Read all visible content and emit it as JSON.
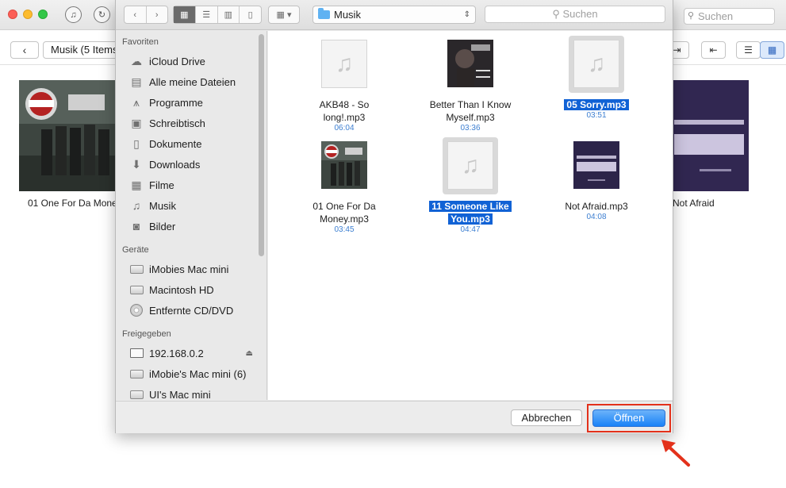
{
  "background_app": {
    "search_placeholder": "Suchen",
    "breadcrumb": "Musik (5 Items",
    "albums": [
      {
        "label": "01 One For Da Mone"
      },
      {
        "label": "Not Afraid"
      }
    ]
  },
  "dialog": {
    "path": "Musik",
    "search_placeholder": "Suchen",
    "sidebar": {
      "sections": [
        {
          "heading": "Favoriten",
          "items": [
            "iCloud Drive",
            "Alle meine Dateien",
            "Programme",
            "Schreibtisch",
            "Dokumente",
            "Downloads",
            "Filme",
            "Musik",
            "Bilder"
          ]
        },
        {
          "heading": "Geräte",
          "items": [
            "iMobies Mac mini",
            "Macintosh HD",
            "Entfernte CD/DVD"
          ]
        },
        {
          "heading": "Freigegeben",
          "items": [
            "192.168.0.2",
            "iMobie's Mac mini (6)",
            "UI's Mac mini"
          ]
        }
      ]
    },
    "files": [
      {
        "line1": "AKB48 - So",
        "line2": "long!.mp3",
        "duration": "06:04"
      },
      {
        "line1": "Better Than I Know",
        "line2": "Myself.mp3",
        "duration": "03:36"
      },
      {
        "line1": "05 Sorry.mp3",
        "line2": "",
        "duration": "03:51"
      },
      {
        "line1": "01 One For Da",
        "line2": "Money.mp3",
        "duration": "03:45"
      },
      {
        "line1": "11 Someone Like",
        "line2": "You.mp3",
        "duration": "04:47"
      },
      {
        "line1": "Not Afraid.mp3",
        "line2": "",
        "duration": "04:08"
      }
    ],
    "buttons": {
      "cancel": "Abbrechen",
      "open": "Öffnen"
    },
    "accent_color": "#1162d5",
    "highlight_color": "#e3311b"
  }
}
